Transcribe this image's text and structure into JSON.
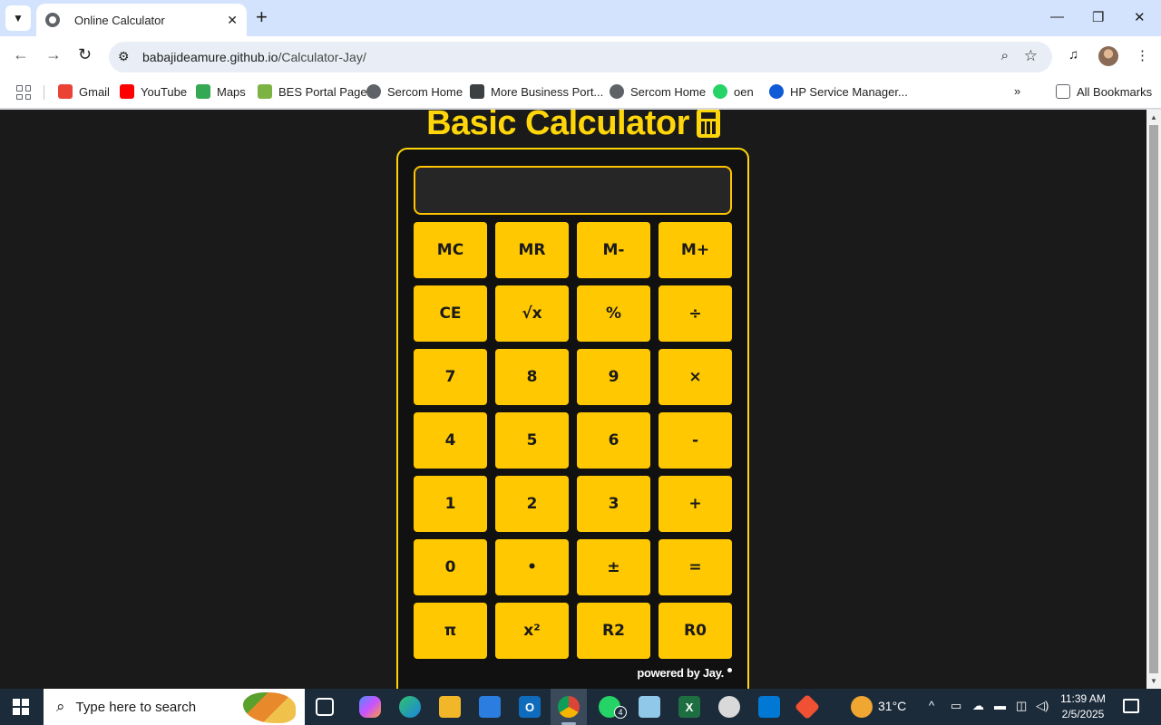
{
  "browser": {
    "tab_title": "Online Calculator",
    "url_host": "babajideamure.github.io",
    "url_path": "/Calculator-Jay/"
  },
  "bookmarks": [
    {
      "label": "Gmail",
      "color": "#ea4335"
    },
    {
      "label": "YouTube",
      "color": "#ff0000"
    },
    {
      "label": "Maps",
      "color": "#34a853"
    },
    {
      "label": "BES Portal Page",
      "color": "#7cb342"
    },
    {
      "label": "Sercom Home",
      "color": "#5f6368"
    },
    {
      "label": "More Business Port...",
      "color": "#3c4043"
    },
    {
      "label": "Sercom Home",
      "color": "#5f6368"
    },
    {
      "label": "oen",
      "color": "#25d366"
    },
    {
      "label": "HP Service Manager...",
      "color": "#0f5bd7"
    }
  ],
  "bookmarks_all": "All Bookmarks",
  "calculator": {
    "title": "Basic Calculator",
    "display_value": "",
    "powered_by": "powered by Jay.",
    "keys": [
      "MC",
      "MR",
      "M-",
      "M+",
      "CE",
      "√x",
      "%",
      "÷",
      "7",
      "8",
      "9",
      "×",
      "4",
      "5",
      "6",
      "-",
      "1",
      "2",
      "3",
      "+",
      "0",
      "•",
      "±",
      "=",
      "π",
      "x²",
      "R2",
      "R0"
    ],
    "accent_color": "#ffc800"
  },
  "taskbar": {
    "search_placeholder": "Type here to search",
    "weather": "31°C",
    "time": "11:39 AM",
    "date": "2/5/2025",
    "whatsapp_badge": "4"
  }
}
